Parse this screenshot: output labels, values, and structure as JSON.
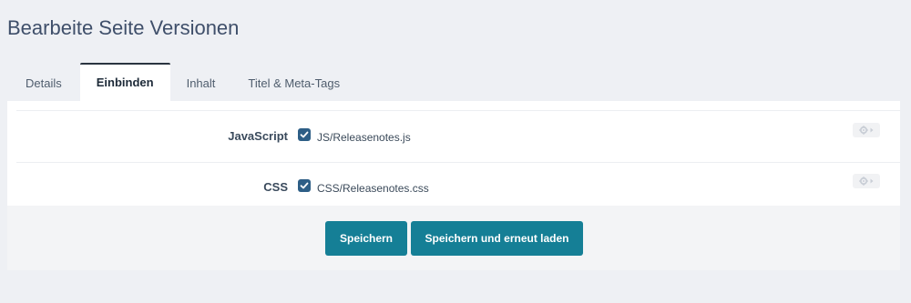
{
  "header": {
    "title": "Bearbeite Seite Versionen"
  },
  "tabs": [
    {
      "label": "Details",
      "active": false
    },
    {
      "label": "Einbinden",
      "active": true
    },
    {
      "label": "Inhalt",
      "active": false
    },
    {
      "label": "Titel & Meta-Tags",
      "active": false
    }
  ],
  "form": {
    "rows": [
      {
        "label": "JavaScript",
        "value": "JS/Releasenotes.js",
        "checked": true,
        "options_icon": "gear-caret-icon"
      },
      {
        "label": "CSS",
        "value": "CSS/Releasenotes.css",
        "checked": true,
        "options_icon": "gear-caret-icon"
      }
    ]
  },
  "footer": {
    "save_label": "Speichern",
    "save_reload_label": "Speichern und erneut laden"
  },
  "colors": {
    "accent": "#157f96",
    "checkbox": "#2d5e86",
    "background": "#eef0f4"
  }
}
